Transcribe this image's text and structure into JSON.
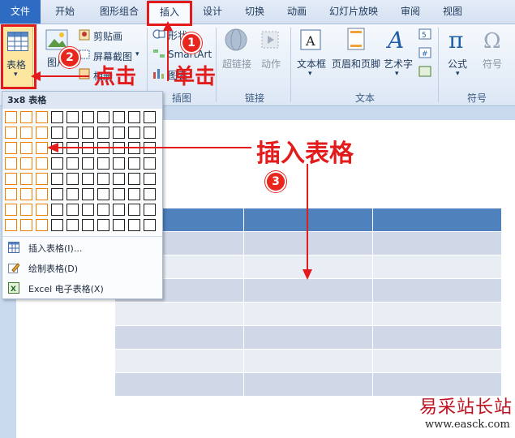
{
  "tabs": [
    "文件",
    "开始",
    "图形组合",
    "插入",
    "设计",
    "切换",
    "动画",
    "幻灯片放映",
    "审阅",
    "视图"
  ],
  "ribbon": {
    "table_btn": "表格",
    "image_btn": "图片",
    "clipart_btn": "剪贴画",
    "screenshot_btn": "屏幕截图",
    "album_btn": "相册",
    "shapes_btn": "形状",
    "smartart_btn": "SmartArt",
    "chart_btn": "图表",
    "hyperlink_btn": "超链接",
    "action_btn": "动作",
    "textbox_btn": "文本框",
    "header_btn": "页眉和页脚",
    "wordart_btn": "艺术字",
    "equation_btn": "公式",
    "symbol_btn": "符号",
    "groups": {
      "illustrations": "插图",
      "links": "链接",
      "text": "文本",
      "symbols": "符号"
    }
  },
  "menu": {
    "header": "3x8 表格",
    "grid_cols": 10,
    "grid_rows": 8,
    "selected_cols": 3,
    "selected_rows": 8,
    "items": [
      {
        "label": "插入表格(I)..."
      },
      {
        "label": "绘制表格(D)"
      },
      {
        "label": "Excel 电子表格(X)"
      }
    ]
  },
  "annotations": {
    "step1_num": "1",
    "step2_num": "2",
    "step3_num": "3",
    "click_text_1": "单击",
    "click_text_2": "点击",
    "insert_table_text": "插入表格"
  },
  "watermark": {
    "title": "易采站长站",
    "url": "www.easck.com"
  },
  "colors": {
    "table_header": "#4f81bd",
    "table_row": "#d0d8e8",
    "accent_red": "#e31b1b"
  }
}
